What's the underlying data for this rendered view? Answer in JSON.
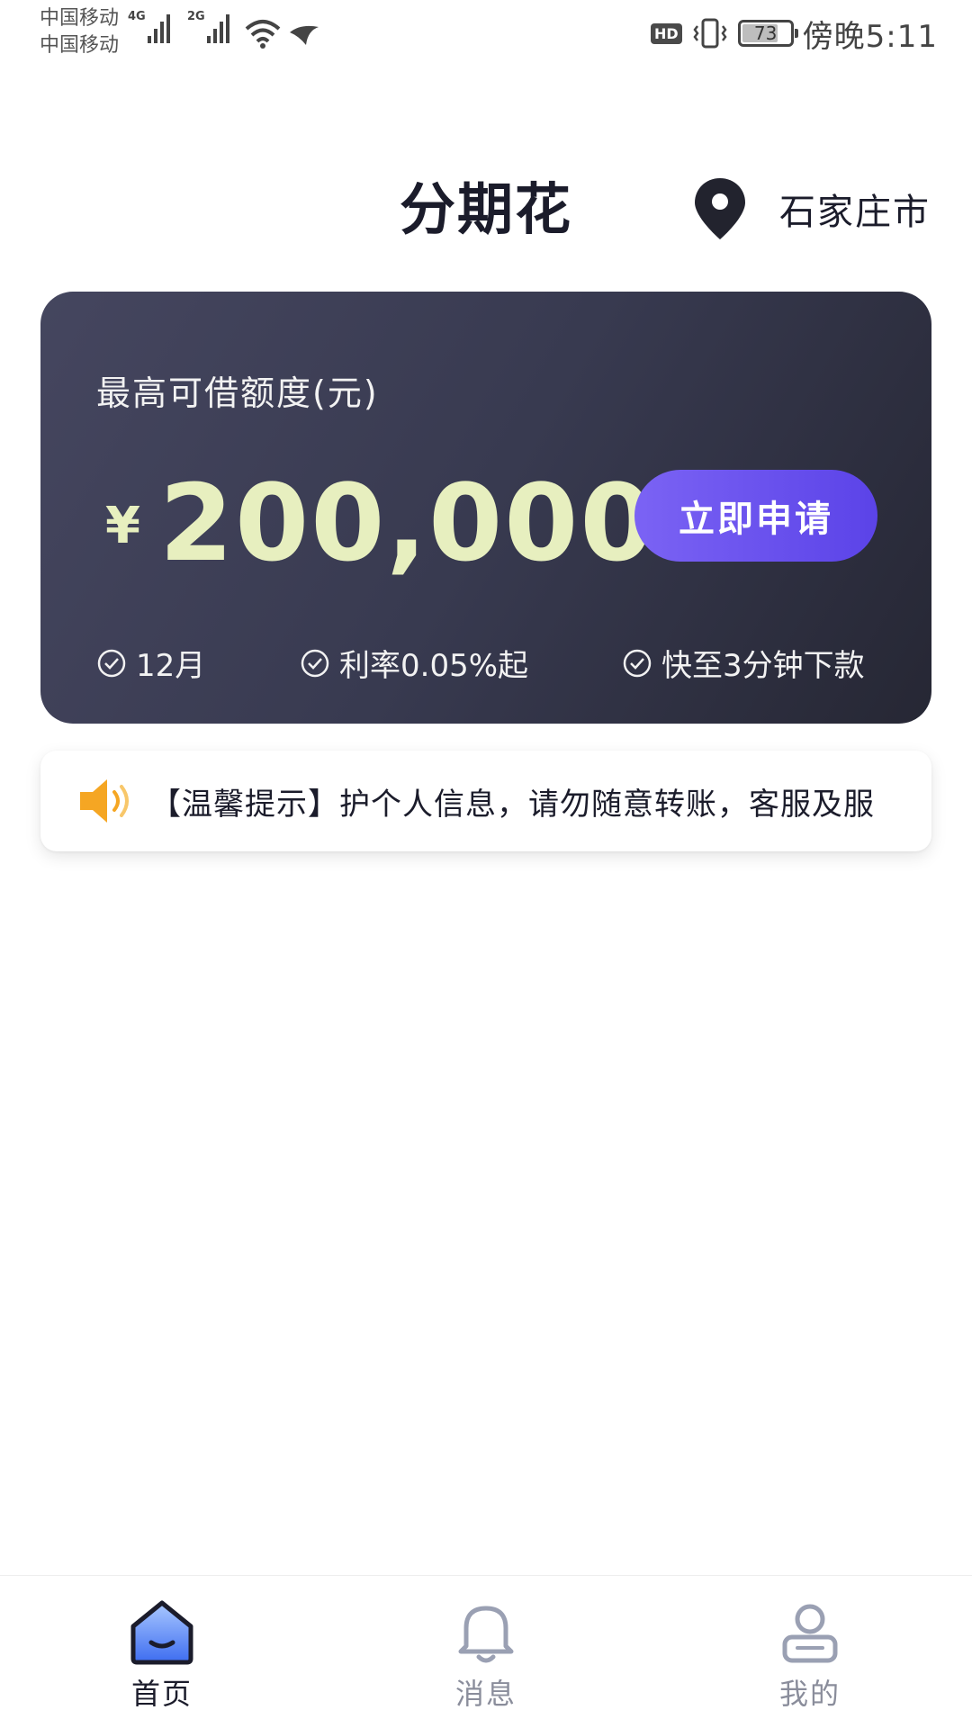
{
  "status_bar": {
    "carrier_1": "中国移动",
    "carrier_2": "中国移动",
    "network_1": "4G",
    "network_2": "2G",
    "hd": "HD",
    "battery": "73",
    "time": "傍晚5:11"
  },
  "header": {
    "title": "分期花",
    "location": "石家庄市",
    "location_icon": "map-pin-icon"
  },
  "loan_card": {
    "label": "最高可借额度(元)",
    "currency": "¥",
    "amount": "200,000",
    "apply_label": "立即申请",
    "features": [
      "12月",
      "利率0.05%起",
      "快至3分钟下款"
    ]
  },
  "notice": {
    "icon": "speaker-icon",
    "text": "【温馨提示】护个人信息，请勿随意转账，客服及服"
  },
  "bottom_nav": {
    "items": [
      {
        "label": "首页",
        "icon": "home-icon",
        "active": true
      },
      {
        "label": "消息",
        "icon": "bell-icon",
        "active": false
      },
      {
        "label": "我的",
        "icon": "profile-icon",
        "active": false
      }
    ]
  },
  "colors": {
    "card_start": "#45465f",
    "card_end": "#262734",
    "amount": "#e7efbf",
    "button_start": "#7b63f4",
    "button_end": "#5b43e8",
    "speaker": "#f5a623",
    "nav_active": "#1b1c2b",
    "nav_inactive": "#8a8d9b"
  }
}
